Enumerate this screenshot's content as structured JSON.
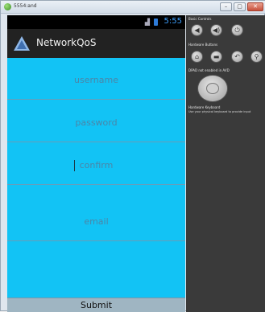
{
  "window": {
    "title": "5554:and",
    "minimize_label": "–",
    "maximize_label": "▢",
    "close_label": "✕"
  },
  "status_bar": {
    "signal_icon": "signal-icon",
    "battery_icon": "battery-icon",
    "time": "5:55"
  },
  "action_bar": {
    "app_title": "NetworkQoS",
    "logo_icon": "app-logo-icon"
  },
  "form": {
    "username_placeholder": "username",
    "password_placeholder": "password",
    "confirm_placeholder": "confirm",
    "email_placeholder": "email",
    "submit_label": "Submit"
  },
  "emulator_controls": {
    "basic_controls_label": "Basic Controls",
    "hardware_buttons_label": "Hardware Buttons",
    "dpad_label": "DPAD not enabled in AVD",
    "keyboard_label": "Hardware Keyboard",
    "keyboard_note": "Use your physical keyboard to provide input",
    "basic_buttons": [
      {
        "icon": "volume-down-icon",
        "glyph": "◀"
      },
      {
        "icon": "volume-up-icon",
        "glyph": "◀)"
      },
      {
        "icon": "power-icon",
        "glyph": "⏻"
      }
    ],
    "hardware_buttons": [
      {
        "icon": "home-icon",
        "glyph": "⌂"
      },
      {
        "icon": "menu-icon",
        "glyph": "▬"
      },
      {
        "icon": "back-icon",
        "glyph": "↶"
      },
      {
        "icon": "search-icon",
        "glyph": "⚲"
      }
    ]
  },
  "colors": {
    "content_background": "#12c3f5",
    "action_bar": "#222222",
    "clock": "#3ea0ff"
  }
}
